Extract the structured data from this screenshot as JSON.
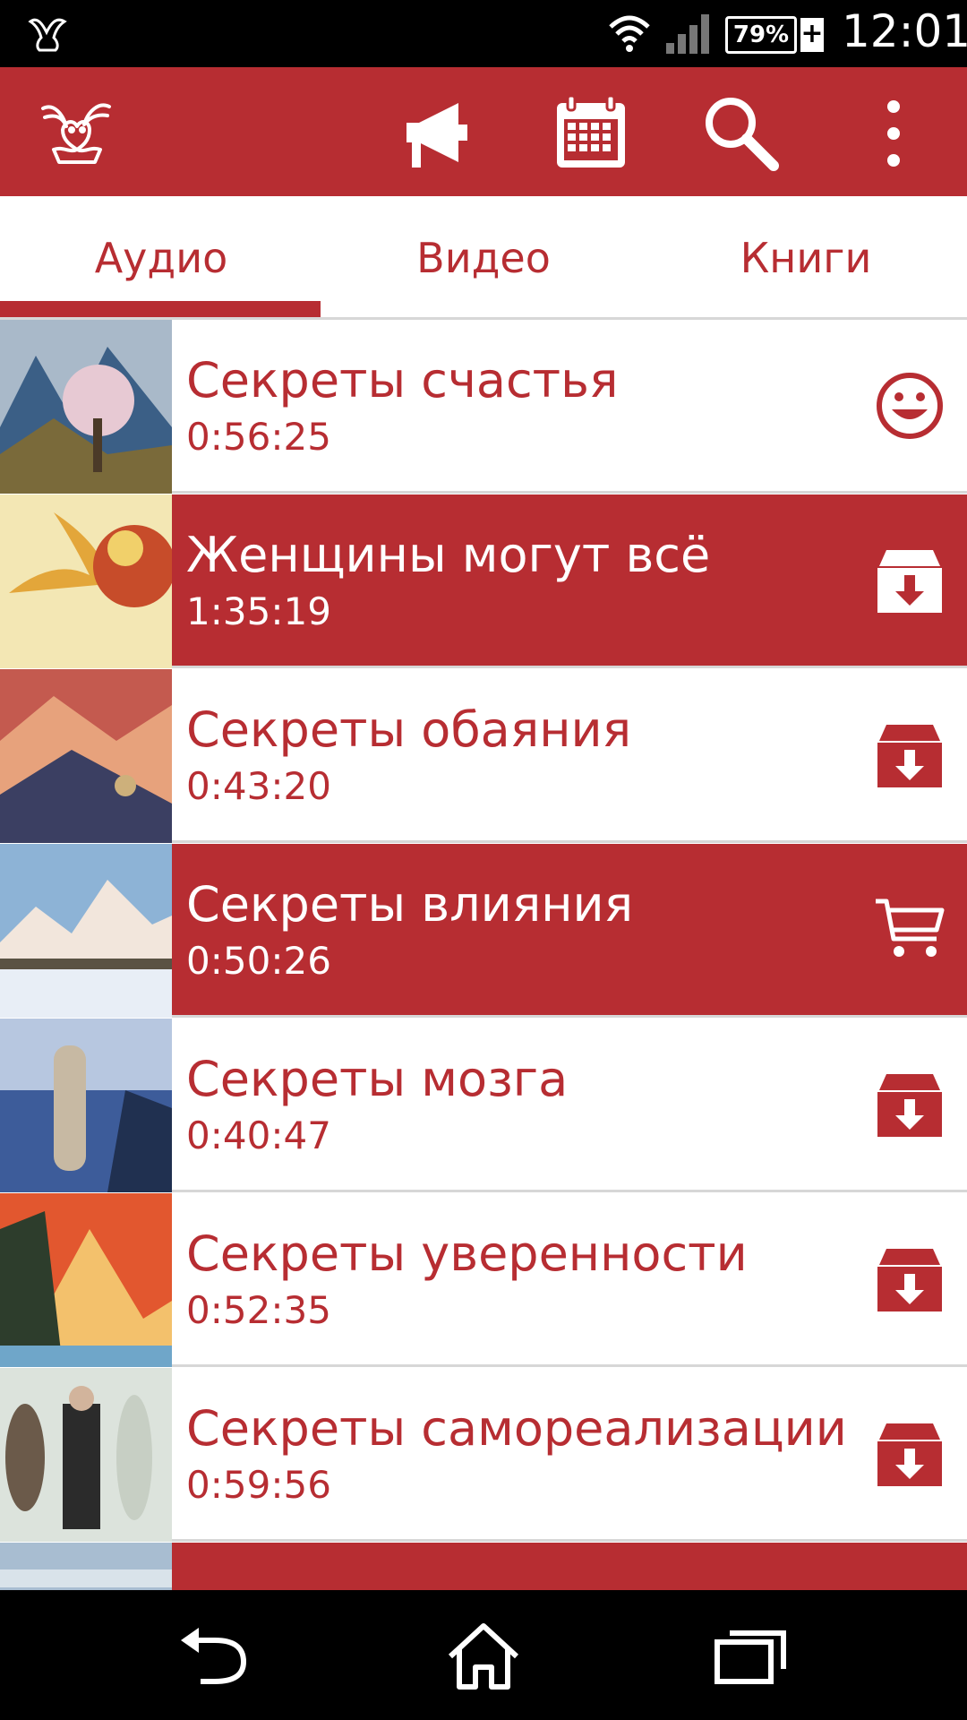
{
  "status_bar": {
    "battery": "79%",
    "battery_charging": "+",
    "time": "12:01"
  },
  "app_bar": {
    "icons": [
      "bird-logo-icon",
      "megaphone-icon",
      "calendar-icon",
      "search-icon",
      "more-vert-icon"
    ]
  },
  "tabs": [
    {
      "label": "Аудио",
      "selected": true
    },
    {
      "label": "Видео",
      "selected": false
    },
    {
      "label": "Книги",
      "selected": false
    }
  ],
  "items": [
    {
      "title": "Секреты счастья",
      "duration": "0:56:25",
      "style": "light",
      "icon": "smile-icon"
    },
    {
      "title": "Женщины могут всё",
      "duration": "1:35:19",
      "style": "dark",
      "icon": "download-box-icon"
    },
    {
      "title": "Секреты обаяния",
      "duration": "0:43:20",
      "style": "light",
      "icon": "download-box-icon"
    },
    {
      "title": "Секреты влияния",
      "duration": "0:50:26",
      "style": "dark",
      "icon": "cart-icon"
    },
    {
      "title": "Секреты мозга",
      "duration": "0:40:47",
      "style": "light",
      "icon": "download-box-icon"
    },
    {
      "title": "Секреты уверенности",
      "duration": "0:52:35",
      "style": "light",
      "icon": "download-box-icon"
    },
    {
      "title": "Секреты самореализации",
      "duration": "0:59:56",
      "style": "light",
      "icon": "download-box-icon"
    },
    {
      "title": "",
      "duration": "",
      "style": "dark",
      "icon": ""
    }
  ],
  "colors": {
    "brand": "#b72d32",
    "divider": "#d7d7d7"
  }
}
